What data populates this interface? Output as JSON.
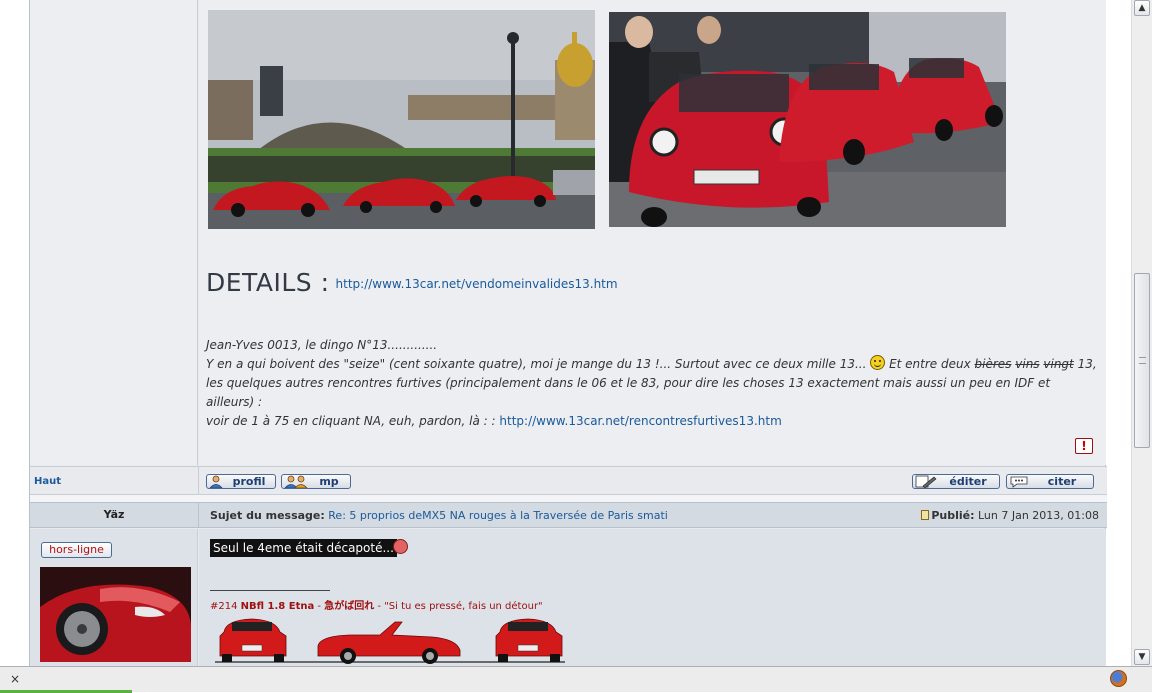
{
  "post1": {
    "details_heading": "DETAILS :",
    "details_link": "http://www.13car.net/vendomeinvalides13.htm",
    "story_line1": "Jean-Yves 0013, le dingo N°13.............",
    "story_line2a": "Y en a qui boivent des \"seize\" (cent soixante quatre), moi je mange du 13 !... Surtout avec ce deux mille 13...",
    "story_line2b": "Et entre deux",
    "story_strike1": "bières",
    "story_strike2": "vins",
    "story_strike3": "vingt",
    "story_line2c": "13,",
    "story_line3": "les quelques autres rencontres furtives (principalement dans le 06 et le 83, pour dire les choses 13 exactement mais aussi un peu en IDF et ailleurs) :",
    "story_line4": "voir de 1 à 75 en cliquant NA, euh, pardon, là : :",
    "story_link": "http://www.13car.net/rencontresfurtives13.htm",
    "report_label": "!"
  },
  "actions": {
    "top_link": "Haut",
    "profile": "profil",
    "pm": "mp",
    "edit": "éditer",
    "quote": "citer"
  },
  "post2": {
    "author": "Yäz",
    "subject_label": "Sujet du message:",
    "subject": "Re: 5 proprios deMX5 NA rouges à la Traversée de Paris smati",
    "posted_label": "Publié:",
    "posted_date": "Lun 7 Jan 2013, 01:08",
    "status": "hors-ligne",
    "message": "Seul le 4eme était décapoté...",
    "sig_number": "#214",
    "sig_car": "NBfl 1.8 Etna",
    "sig_dash1": "-",
    "sig_japanese": "急がば回れ",
    "sig_dash2": "-",
    "sig_quote": "\"Si tu es pressé, fais un détour\""
  },
  "browser": {
    "scroll_up": "▲",
    "scroll_down": "▼",
    "find_close": "×"
  },
  "colors": {
    "link": "#1a5a9a",
    "accent_red": "#b01010",
    "header_bg": "#d4dae2"
  }
}
